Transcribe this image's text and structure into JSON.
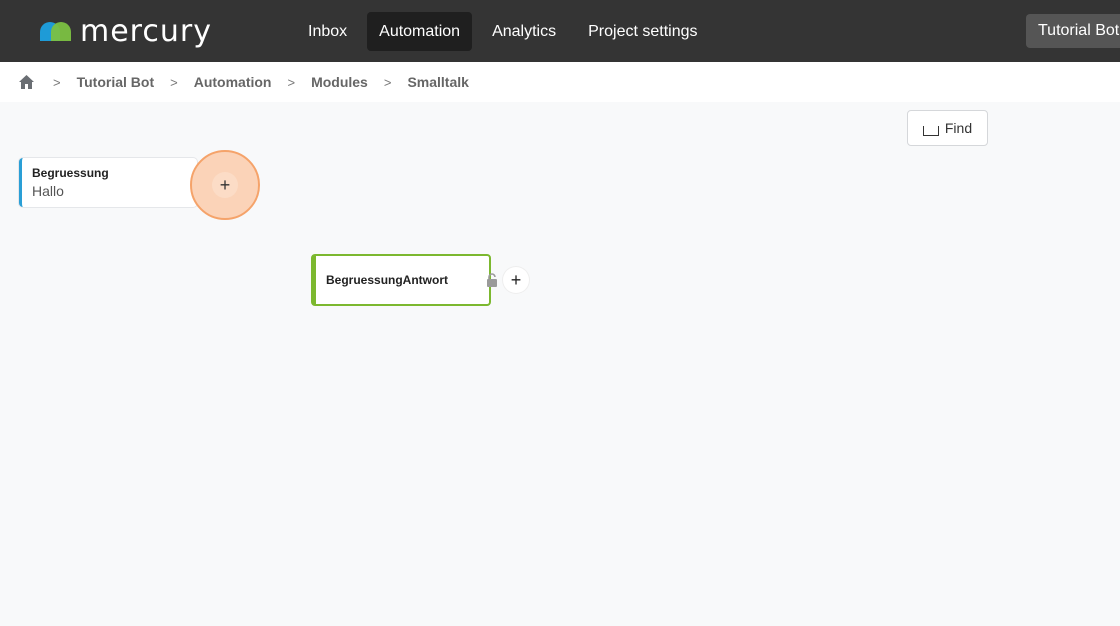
{
  "app": {
    "logo_text": "mercury",
    "nav": [
      {
        "label": "Inbox"
      },
      {
        "label": "Automation"
      },
      {
        "label": "Analytics"
      },
      {
        "label": "Project settings"
      }
    ],
    "project_button": "Tutorial Bot"
  },
  "breadcrumb": [
    "Tutorial Bot",
    "Automation",
    "Modules",
    "Smalltalk"
  ],
  "canvas": {
    "find_label": "Find",
    "node_a": {
      "title": "Begruessung",
      "subtitle": "Hallo"
    },
    "node_b": {
      "title": "BegruessungAntwort"
    },
    "add_symbol": "+"
  },
  "colors": {
    "topbar": "#343434",
    "accent_blue": "#2a9fd6",
    "accent_green": "#7cb82f",
    "highlight_orange": "#f5a36a"
  }
}
